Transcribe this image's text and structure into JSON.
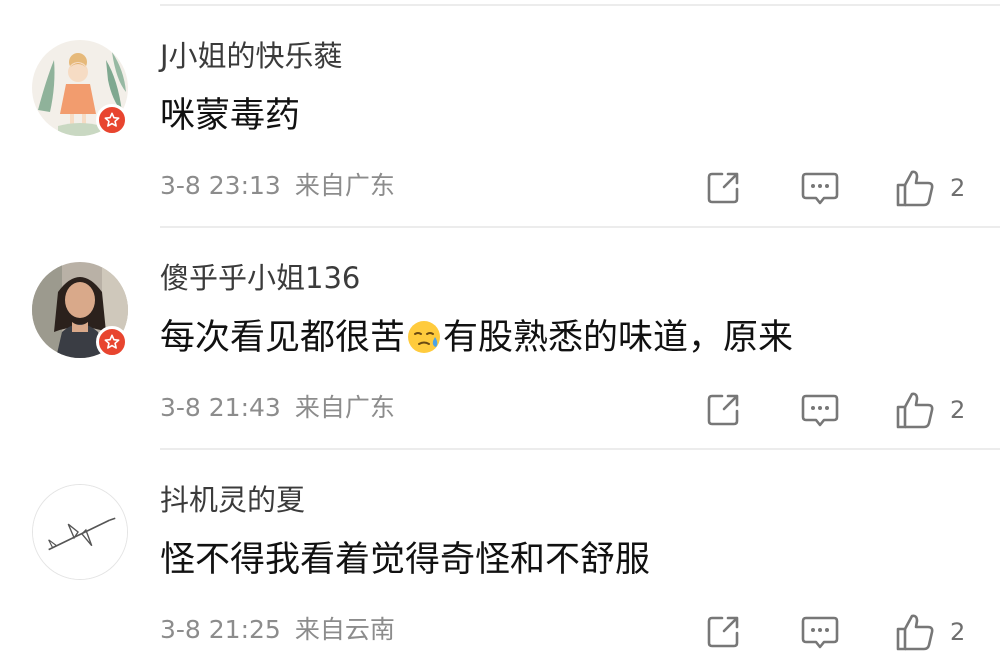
{
  "comments": [
    {
      "username": "J小姐的快乐蕤",
      "text": "咪蒙毒药",
      "text_after_emoji": "",
      "has_emoji": false,
      "avatar": "cartoon-girl-avatar",
      "time": "3-8 23:13",
      "location": "来自广东",
      "likes": "2"
    },
    {
      "username": "傻乎乎小姐136",
      "text": "每次看见都很苦",
      "text_after_emoji": "有股熟悉的味道，原来",
      "has_emoji": true,
      "emoji": "sweat-face-emoji",
      "avatar": "photo-woman-avatar",
      "time": "3-8 21:43",
      "location": "来自广东",
      "likes": "2"
    },
    {
      "username": "抖机灵的夏",
      "text": "怪不得我看着觉得奇怪和不舒服",
      "text_after_emoji": "",
      "has_emoji": false,
      "avatar": "airplane-sketch-avatar",
      "time": "3-8 21:25",
      "location": "来自云南",
      "likes": "2"
    }
  ],
  "colors": {
    "vip_badge": "#e8452f",
    "username": "#3b3b3b",
    "text": "#111111",
    "meta": "#8c8c8c",
    "divider": "#ececec"
  }
}
